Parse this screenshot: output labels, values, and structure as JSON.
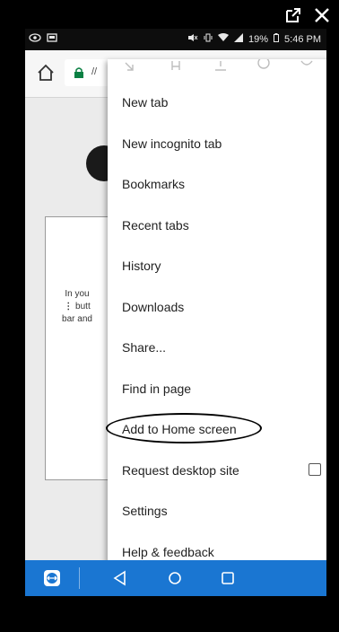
{
  "status_bar": {
    "battery": "19%",
    "time": "5:46 PM"
  },
  "browser": {
    "url_fragment": "//"
  },
  "page": {
    "text_fragments": [
      "In you",
      "butt",
      "bar and"
    ]
  },
  "menu": {
    "items": [
      {
        "label": "New tab"
      },
      {
        "label": "New incognito tab"
      },
      {
        "label": "Bookmarks"
      },
      {
        "label": "Recent tabs"
      },
      {
        "label": "History"
      },
      {
        "label": "Downloads"
      },
      {
        "label": "Share..."
      },
      {
        "label": "Find in page"
      },
      {
        "label": "Add to Home screen"
      },
      {
        "label": "Request desktop site"
      },
      {
        "label": "Settings"
      },
      {
        "label": "Help & feedback"
      }
    ],
    "icon_row": [
      "forward-icon",
      "bookmark-star-icon",
      "download-icon",
      "info-icon",
      "refresh-icon"
    ]
  },
  "colors": {
    "nav_bar": "#1a76d2",
    "menu_bg": "#ffffff",
    "status_bar_bg": "#0d0d0d",
    "page_bg": "#ebebeb"
  },
  "icons": {
    "top_controls": [
      "external-link-icon",
      "close-icon"
    ],
    "nav": [
      "teamviewer-icon",
      "back-icon",
      "home-icon",
      "recents-icon"
    ]
  }
}
